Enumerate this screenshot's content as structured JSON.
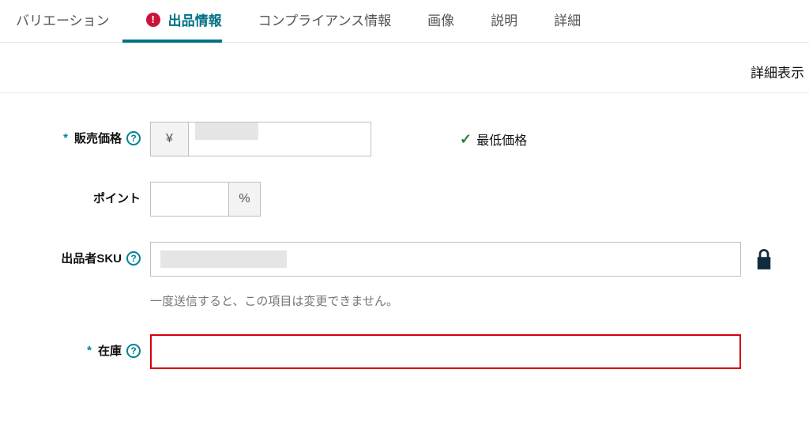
{
  "tabs": {
    "variation": "バリエーション",
    "offer": "出品情報",
    "compliance": "コンプライアンス情報",
    "images": "画像",
    "description": "説明",
    "details": "詳細"
  },
  "view_label": "詳細表示",
  "labels": {
    "price": "販売価格",
    "points": "ポイント",
    "sku": "出品者SKU",
    "stock": "在庫"
  },
  "symbols": {
    "currency": "¥",
    "percent": "%",
    "required": "*",
    "help": "?",
    "check": "✓",
    "alert": "!"
  },
  "lowest_price_label": "最低価格",
  "sku_helper": "一度送信すると、この項目は変更できません。"
}
